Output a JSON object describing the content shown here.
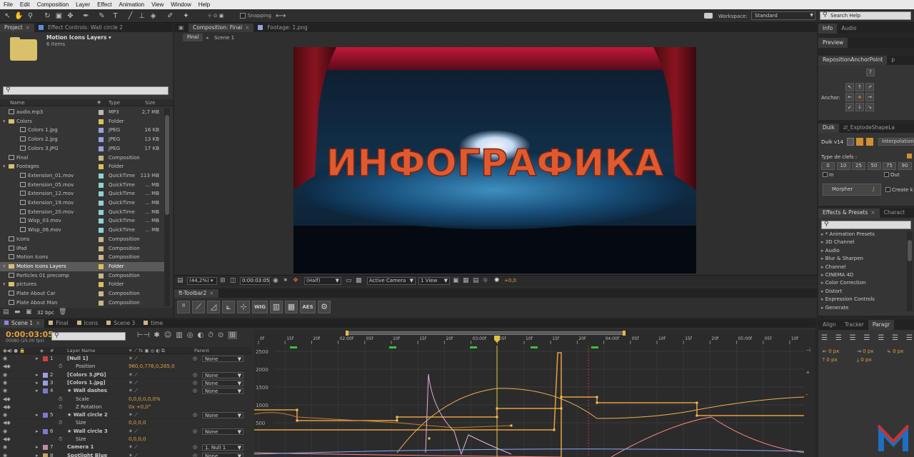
{
  "menu": [
    "File",
    "Edit",
    "Composition",
    "Layer",
    "Effect",
    "Animation",
    "View",
    "Window",
    "Help"
  ],
  "toolbar": {
    "snapping_label": "Snapping",
    "workspace_label": "Workspace:",
    "workspace_value": "Standard",
    "help_placeholder": "Search Help"
  },
  "project": {
    "tab_project": "Project",
    "tab_effect_controls": "Effect Controls: Wall circle 2",
    "thumb_name": "Motion Icons Layers ▾",
    "thumb_count": "6 items",
    "col_name": "Name",
    "col_type": "Type",
    "col_size": "Size",
    "bpc": "32 bpc",
    "rows": [
      {
        "name": "audio.mp3",
        "type": "MP3",
        "size": "2,7 MB",
        "color": "#b9b9b9",
        "indent": 0,
        "kind": "file"
      },
      {
        "name": "Colors",
        "type": "Folder",
        "size": "",
        "color": "#d7c25a",
        "indent": 0,
        "kind": "folder"
      },
      {
        "name": "Colors 1.jpg",
        "type": "JPEG",
        "size": "16 KB",
        "color": "#9a9fe0",
        "indent": 1,
        "kind": "file"
      },
      {
        "name": "Colors 2.jpg",
        "type": "JPEG",
        "size": "13 KB",
        "color": "#9a9fe0",
        "indent": 1,
        "kind": "file"
      },
      {
        "name": "Colors 3.JPG",
        "type": "JPEG",
        "size": "17 KB",
        "color": "#9a9fe0",
        "indent": 1,
        "kind": "file"
      },
      {
        "name": "Final",
        "type": "Composition",
        "size": "",
        "color": "#c7b68a",
        "indent": 0,
        "kind": "comp"
      },
      {
        "name": "Footages",
        "type": "Folder",
        "size": "",
        "color": "#d7c25a",
        "indent": 0,
        "kind": "folder"
      },
      {
        "name": "Extension_01.mov",
        "type": "QuickTime",
        "size": "113 MB",
        "color": "#8fd2d2",
        "indent": 1,
        "kind": "file"
      },
      {
        "name": "Extension_05.mov",
        "type": "QuickTime",
        "size": "... MB",
        "color": "#8fd2d2",
        "indent": 1,
        "kind": "file"
      },
      {
        "name": "Extension_12.mov",
        "type": "QuickTime",
        "size": "... MB",
        "color": "#8fd2d2",
        "indent": 1,
        "kind": "file"
      },
      {
        "name": "Extension_19.mov",
        "type": "QuickTime",
        "size": "... MB",
        "color": "#8fd2d2",
        "indent": 1,
        "kind": "file"
      },
      {
        "name": "Extension_20.mov",
        "type": "QuickTime",
        "size": "... MB",
        "color": "#8fd2d2",
        "indent": 1,
        "kind": "file"
      },
      {
        "name": "Wisp_03.mov",
        "type": "QuickTime",
        "size": "... MB",
        "color": "#8fd2d2",
        "indent": 1,
        "kind": "file"
      },
      {
        "name": "Wisp_06.mov",
        "type": "QuickTime",
        "size": "... MB",
        "color": "#8fd2d2",
        "indent": 1,
        "kind": "file"
      },
      {
        "name": "Icons",
        "type": "Composition",
        "size": "",
        "color": "#c7b68a",
        "indent": 0,
        "kind": "comp"
      },
      {
        "name": "iPad",
        "type": "Composition",
        "size": "",
        "color": "#c7b68a",
        "indent": 0,
        "kind": "comp"
      },
      {
        "name": "Motion Icons",
        "type": "Composition",
        "size": "",
        "color": "#c7b68a",
        "indent": 0,
        "kind": "comp"
      },
      {
        "name": "Motion Icons Layers",
        "type": "Folder",
        "size": "",
        "color": "#d7c25a",
        "indent": 0,
        "kind": "folder",
        "selected": true
      },
      {
        "name": "Particles 01 precomp",
        "type": "Composition",
        "size": "",
        "color": "#c7b68a",
        "indent": 0,
        "kind": "comp"
      },
      {
        "name": "pictures",
        "type": "Folder",
        "size": "",
        "color": "#d7c25a",
        "indent": 0,
        "kind": "folder"
      },
      {
        "name": "Plate About Car",
        "type": "Composition",
        "size": "",
        "color": "#c7b68a",
        "indent": 0,
        "kind": "comp"
      },
      {
        "name": "Plate About Man",
        "type": "Composition",
        "size": "",
        "color": "#c7b68a",
        "indent": 0,
        "kind": "comp"
      }
    ]
  },
  "viewer": {
    "tab_comp": "Composition: Final",
    "tab_footage": "Footage: 1.png",
    "crumb1": "Final",
    "crumb2": "Scene 1",
    "title_text": "ИНФОГРАФИКА",
    "zoom": "(44,2%)",
    "timecode": "0:00:03:05",
    "resolution": "(Half)",
    "camera": "Active Camera",
    "views": "1 View",
    "exposure": "+0,0"
  },
  "fttoolbar": {
    "tab": "ft-Toolbar2",
    "wig": "WIG",
    "aes": "AES"
  },
  "right": {
    "tab_info": "Info",
    "tab_audio": "Audio",
    "tab_preview": "Preview",
    "reposition_tab": "RepositionAnchorPoint",
    "reposition_tab2": "p",
    "anchor_label": "Anchor:",
    "question": "?",
    "duik_tab": "Duik",
    "duik_tab2": "zl_ExplodeShapeLa",
    "duik_version": "Duik v14",
    "interpolation": "Interpolation",
    "type_clefs": "Type de clefs :",
    "clef_values": [
      "0",
      "10",
      "25",
      "50",
      "75",
      "90"
    ],
    "in_label": "In",
    "out_label": "Out",
    "morpher": "Morpher",
    "create_key": "Create k",
    "effects_tab": "Effects & Presets",
    "effects_tab2": "Charact",
    "effects": [
      "* Animation Presets",
      "3D Channel",
      "Audio",
      "Blur & Sharpen",
      "Channel",
      "CINEMA 4D",
      "Color Correction",
      "Distort",
      "Expression Controls",
      "Generate"
    ],
    "align_tab": "Align",
    "tracker_tab": "Tracker",
    "paragraph_tab": "Paragr",
    "para_values": [
      "0 px",
      "0 px",
      "0 px",
      "0 px",
      "0 px"
    ]
  },
  "timeline": {
    "tabs": [
      "Scene 1",
      "Final",
      "Icons",
      "Scene 3",
      "time"
    ],
    "timecode": "0:00:03:05",
    "fps": "00080 (25.00 fps)",
    "col_layer": "Layer Name",
    "col_parent": "Parent",
    "col_hash": "#",
    "ruler": [
      "0f",
      "15f",
      "20f",
      "02:00f",
      "05f",
      "10f",
      "15f",
      "20f",
      "03:00f",
      "05f",
      "10f",
      "15f",
      "20f",
      "04:00f",
      "05f",
      "10f",
      "15f",
      "20f",
      "05:00f",
      "05f",
      "10f"
    ],
    "graph_labels": [
      "2500",
      "2000",
      "1500",
      "1000",
      "500"
    ],
    "rows": [
      {
        "num": "1",
        "name": "[Null 1]",
        "color": "#d04040",
        "parent": "None",
        "type": "layer",
        "bold": true
      },
      {
        "num": "",
        "name": "Position",
        "value": "960,0,776,0,265,0",
        "type": "prop"
      },
      {
        "num": "2",
        "name": "[Colors 3.JPG]",
        "color": "#9a9fe0",
        "parent": "None",
        "type": "layer",
        "bold": true
      },
      {
        "num": "3",
        "name": "[Colors 1.jpg]",
        "color": "#9a9fe0",
        "parent": "None",
        "type": "layer",
        "bold": true
      },
      {
        "num": "4",
        "name": "★ Wall dashes",
        "color": "#7a7ac8",
        "parent": "None",
        "type": "layer",
        "bold": true
      },
      {
        "num": "",
        "name": "Scale",
        "value": "0,0,0,0,0,0%",
        "type": "prop"
      },
      {
        "num": "",
        "name": "Z Rotation",
        "value": "0x +0,0°",
        "type": "prop"
      },
      {
        "num": "5",
        "name": "★ Wall circle 2",
        "color": "#7a7ac8",
        "parent": "None",
        "type": "layer",
        "bold": true
      },
      {
        "num": "",
        "name": "Size",
        "value": "0,0,0,0",
        "type": "prop"
      },
      {
        "num": "6",
        "name": "★ Wall circle 3",
        "color": "#7a7ac8",
        "parent": "None",
        "type": "layer",
        "bold": true
      },
      {
        "num": "",
        "name": "Size",
        "value": "0,0,0,0",
        "type": "prop"
      },
      {
        "num": "7",
        "name": "Camera 1",
        "color": "#c88aa0",
        "parent": "1. Null 1",
        "type": "layer",
        "bold": true
      },
      {
        "num": "8",
        "name": "Spotlight Blue",
        "color": "#c8a060",
        "parent": "None",
        "type": "layer",
        "bold": true
      }
    ]
  }
}
